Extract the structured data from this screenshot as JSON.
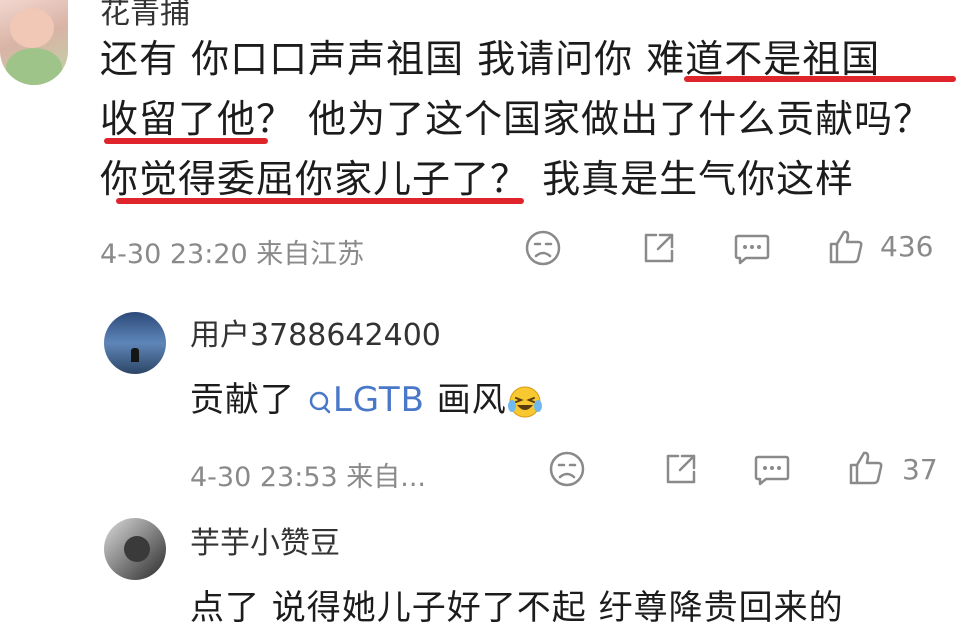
{
  "comment": {
    "author": "花青捕",
    "lines": [
      "还有 你口口声声祖国 我请问你 难道不是祖国",
      "收留了他？ 他为了这个国家做出了什么贡献吗？",
      "你觉得委屈你家儿子了？ 我真是生气你这样"
    ],
    "meta": "4-30 23:20 来自江苏",
    "likes": "436"
  },
  "replies": [
    {
      "author": "用户3788642400",
      "text_prefix": "贡献了 ",
      "link_text": "LGTB",
      "text_suffix": " 画风",
      "meta": "4-30 23:53 来自...",
      "likes": "37"
    },
    {
      "author": "芋芋小赞豆",
      "text": "点了 说得她儿子好了不起 纡尊降贵回来的"
    }
  ],
  "colors": {
    "underline": "#e0242b",
    "link": "#4a78c8",
    "meta": "#8a8a8a"
  },
  "icons": [
    "sad-face-icon",
    "share-icon",
    "comment-icon",
    "thumbs-up-icon",
    "search-link-icon",
    "laugh-cry-emoji-icon"
  ]
}
